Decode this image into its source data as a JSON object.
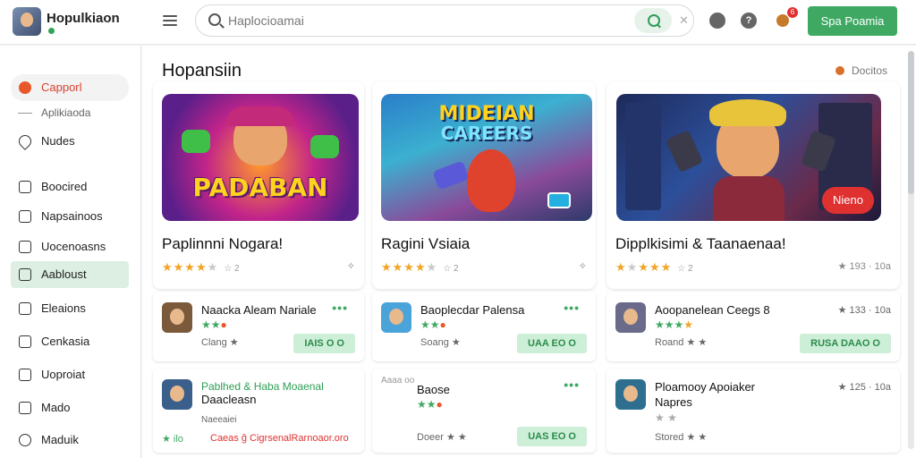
{
  "header": {
    "brand_name": "Hopulkiaon",
    "search_placeholder": "Haplocioamai",
    "search_clear": "✕",
    "help_glyph": "?",
    "notification_count": "6",
    "cta_label": "Spa Poamia"
  },
  "sidebar": {
    "items": [
      {
        "label": "Capporl"
      },
      {
        "label": "Aplikiaoda"
      },
      {
        "label": "Nudes"
      },
      {
        "label": "Boocired"
      },
      {
        "label": "Napsainoos"
      },
      {
        "label": "Uocenoasns"
      },
      {
        "label": "Aabloust"
      },
      {
        "label": "Eleaions"
      },
      {
        "label": "Cenkasia"
      },
      {
        "label": "Uoproiat"
      },
      {
        "label": "Mado"
      },
      {
        "label": "Maduik"
      }
    ]
  },
  "main": {
    "section_title": "Hopansiin",
    "filter_label": "Docitos",
    "featured": [
      {
        "image_text": "PADABAN",
        "title": "Paplinnni Nogara!",
        "rating": 4,
        "rating_text": "☆ 2",
        "more": "✧"
      },
      {
        "image_text_1": "MIDEIAN",
        "image_text_2": "CAREERS",
        "title": "Ragini Vsiaia",
        "rating": 4,
        "rating_text": "☆ 2",
        "more": "✧"
      },
      {
        "badge": "Nieno",
        "title": "Dipplkisimi & Taanaenaa!",
        "rating": 4,
        "rating_text": "☆ 2",
        "more": "★ 193 · 10a"
      }
    ],
    "cards": [
      {
        "name": "Naacka Aleam Nariale",
        "sub": "Clang ★",
        "meta": "•••",
        "price": "IAIS O O",
        "colors": [
          "#7a5a3a",
          "#3a7ab1"
        ]
      },
      {
        "name": "Baoplecdar Palensa",
        "sub": "Soang ★",
        "meta": "•••",
        "price": "UAA EO O",
        "colors": [
          "#4aa3d9",
          "#f0c040"
        ]
      },
      {
        "name": "Aoopanelean Ceegs 8",
        "sub": "Roand ★ ★",
        "meta": "★ 133 · 10a",
        "price": "RUSA DAAO O",
        "colors": [
          "#6a6a8a",
          "#31a45a"
        ]
      },
      {
        "name_1": "Pablhed & Haba Moaenal",
        "name_2": "Daacleasn",
        "line_3": "Naeeaiei",
        "sub": "Caeas ĝ CigrsenalRarnoaor.oro",
        "sub_left": "★ ilo",
        "colors": [
          "#3a5f8a",
          "#d8a060"
        ]
      },
      {
        "name": "Baose",
        "top_label": "Aaaa oo",
        "sub": "Doeer ★ ★",
        "meta": "•••",
        "price": "UAS EO O",
        "colors": [
          "#fff",
          "#fff"
        ]
      },
      {
        "name_1": "Ploamooy Apoiaker",
        "name_2": "Napres",
        "sub": "Stored ★ ★",
        "meta": "★ 125 · 10a",
        "colors": [
          "#2e6f8f",
          "#c0804a"
        ]
      }
    ]
  }
}
